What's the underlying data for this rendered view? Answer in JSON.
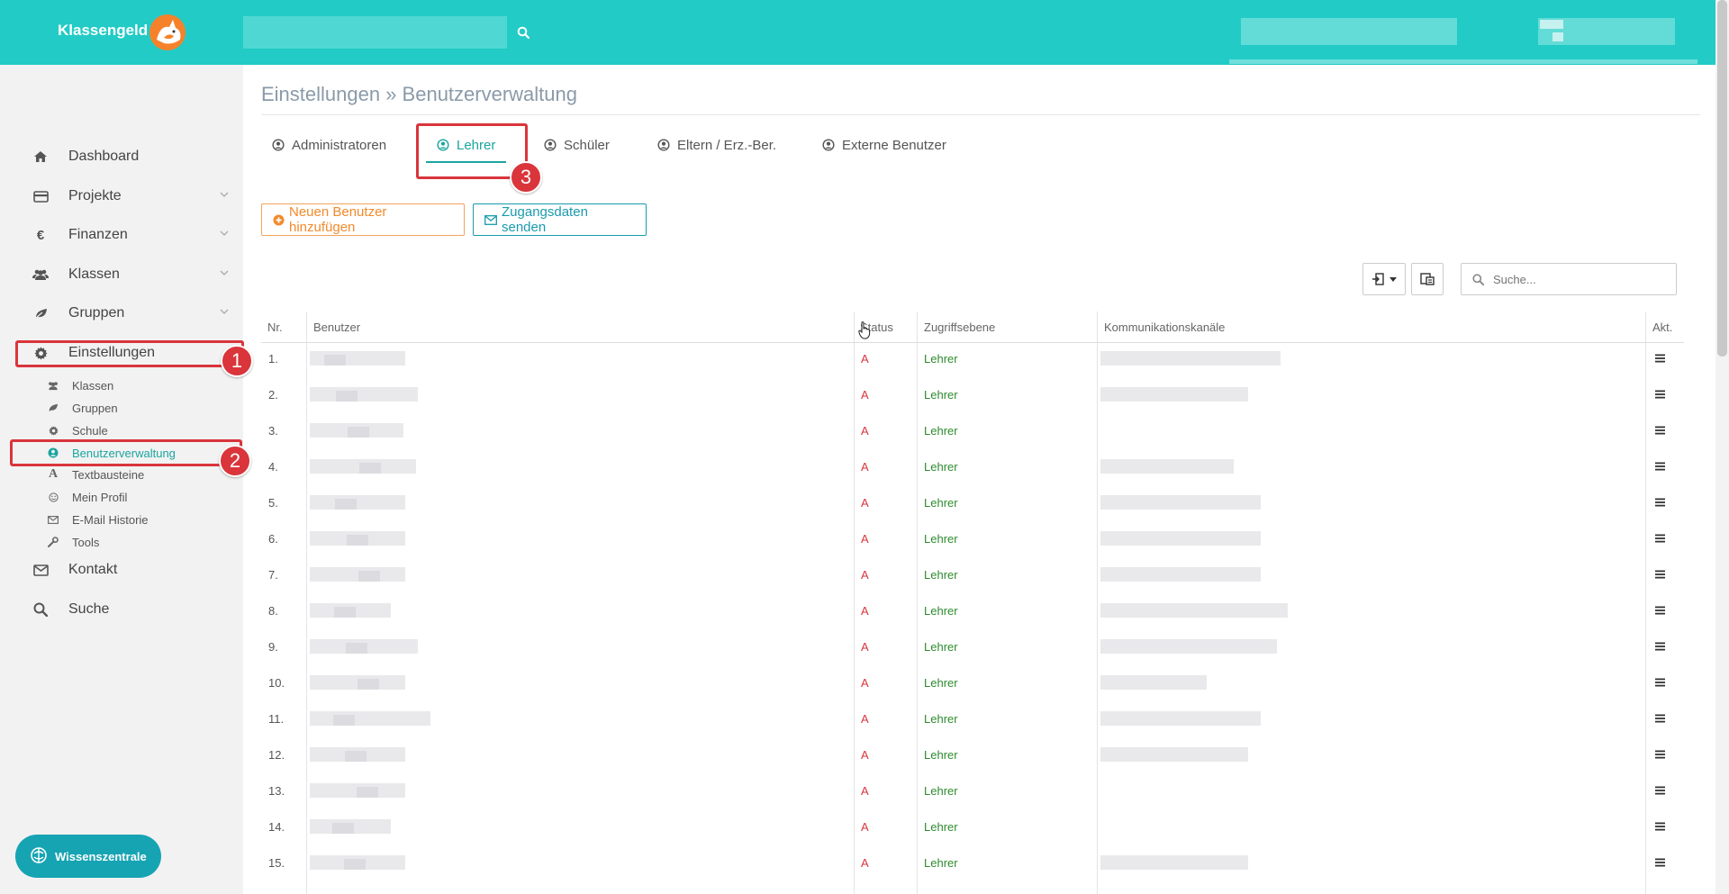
{
  "brand": "Klassengeld",
  "search": {
    "placeholder": ""
  },
  "sidebar": {
    "items": [
      {
        "label": "Dashboard",
        "icon": "home-icon",
        "chevron": false
      },
      {
        "label": "Projekte",
        "icon": "card-icon",
        "chevron": true
      },
      {
        "label": "Finanzen",
        "icon": "euro-icon",
        "chevron": true
      },
      {
        "label": "Klassen",
        "icon": "users-icon",
        "chevron": true
      },
      {
        "label": "Gruppen",
        "icon": "leaf-icon",
        "chevron": true
      },
      {
        "label": "Einstellungen",
        "icon": "gear-icon",
        "chevron": false
      }
    ],
    "sub_items": [
      {
        "label": "Klassen",
        "icon": "users-icon"
      },
      {
        "label": "Gruppen",
        "icon": "leaf-icon"
      },
      {
        "label": "Schule",
        "icon": "gear-icon"
      },
      {
        "label": "Benutzerverwaltung",
        "icon": "user-circle-icon",
        "active": true
      },
      {
        "label": "Textbausteine",
        "icon": "font-icon"
      },
      {
        "label": "Mein Profil",
        "icon": "smile-icon"
      },
      {
        "label": "E-Mail Historie",
        "icon": "envelope-icon"
      },
      {
        "label": "Tools",
        "icon": "wrench-icon"
      }
    ],
    "bottom_items": [
      {
        "label": "Kontakt",
        "icon": "envelope-icon"
      },
      {
        "label": "Suche",
        "icon": "search-icon"
      }
    ],
    "wissenszentrale": "Wissenszentrale"
  },
  "annotations": [
    "1",
    "2",
    "3"
  ],
  "colors": {
    "header": "#22cbc6",
    "accent": "#1aa5a0",
    "highlight": "#d9353b",
    "add_button": "#f28a2b"
  },
  "page": {
    "title": "Einstellungen » Benutzerverwaltung",
    "tabs": [
      {
        "label": "Administratoren"
      },
      {
        "label": "Lehrer",
        "active": true
      },
      {
        "label": "Schüler"
      },
      {
        "label": "Eltern / Erz.-Ber."
      },
      {
        "label": "Externe Benutzer"
      }
    ],
    "add_user_label": "Neuen Benutzer hinzufügen",
    "send_credentials_label": "Zugangsdaten senden",
    "table_search_placeholder": "Suche..."
  },
  "table": {
    "headers": {
      "nr": "Nr.",
      "user": "Benutzer",
      "status": "Status",
      "access": "Zugriffsebene",
      "channels": "Kommunikationskanäle",
      "actions": "Akt."
    },
    "rows": [
      {
        "nr": "1.",
        "status": "A",
        "access": "Lehrer",
        "has_channel": true
      },
      {
        "nr": "2.",
        "status": "A",
        "access": "Lehrer",
        "has_channel": true
      },
      {
        "nr": "3.",
        "status": "A",
        "access": "Lehrer",
        "has_channel": false
      },
      {
        "nr": "4.",
        "status": "A",
        "access": "Lehrer",
        "has_channel": true
      },
      {
        "nr": "5.",
        "status": "A",
        "access": "Lehrer",
        "has_channel": true
      },
      {
        "nr": "6.",
        "status": "A",
        "access": "Lehrer",
        "has_channel": true
      },
      {
        "nr": "7.",
        "status": "A",
        "access": "Lehrer",
        "has_channel": true
      },
      {
        "nr": "8.",
        "status": "A",
        "access": "Lehrer",
        "has_channel": true
      },
      {
        "nr": "9.",
        "status": "A",
        "access": "Lehrer",
        "has_channel": true
      },
      {
        "nr": "10.",
        "status": "A",
        "access": "Lehrer",
        "has_channel": true
      },
      {
        "nr": "11.",
        "status": "A",
        "access": "Lehrer",
        "has_channel": true
      },
      {
        "nr": "12.",
        "status": "A",
        "access": "Lehrer",
        "has_channel": true
      },
      {
        "nr": "13.",
        "status": "A",
        "access": "Lehrer",
        "has_channel": false
      },
      {
        "nr": "14.",
        "status": "A",
        "access": "Lehrer",
        "has_channel": false
      },
      {
        "nr": "15.",
        "status": "A",
        "access": "Lehrer",
        "has_channel": true
      }
    ],
    "action_icon": "menu-icon"
  }
}
